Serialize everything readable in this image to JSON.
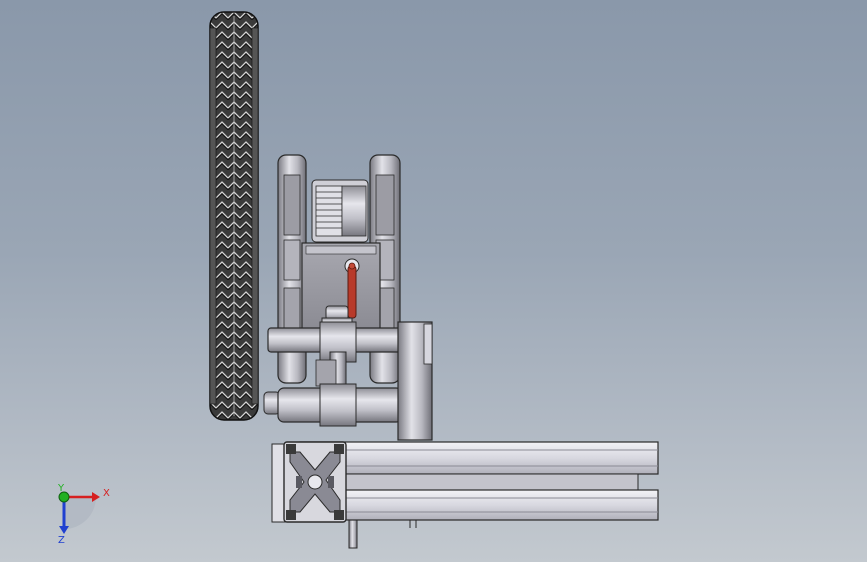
{
  "viewport": {
    "colors": {
      "background_top": "#8a98aa",
      "background_bottom": "#c3c9cf",
      "part_metal": "#c9c9d0",
      "part_outline": "#2a2a2a",
      "pin_accent": "#b83a2a",
      "axis_x": "#d62020",
      "axis_y": "#22b022",
      "axis_z": "#2040d0"
    }
  },
  "model": {
    "parts": [
      {
        "name": "tread-wheel",
        "icon": "tire-icon"
      },
      {
        "name": "motor-bracket",
        "icon": "bracket-icon"
      },
      {
        "name": "gear",
        "icon": "gear-icon"
      },
      {
        "name": "shaft-assembly",
        "icon": "shaft-icon"
      },
      {
        "name": "red-pin",
        "icon": "pin-icon"
      },
      {
        "name": "aluminum-extrusion",
        "icon": "extrusion-icon"
      }
    ]
  },
  "triad": {
    "x_label": "X",
    "y_label": "Y",
    "z_label": "Z"
  }
}
